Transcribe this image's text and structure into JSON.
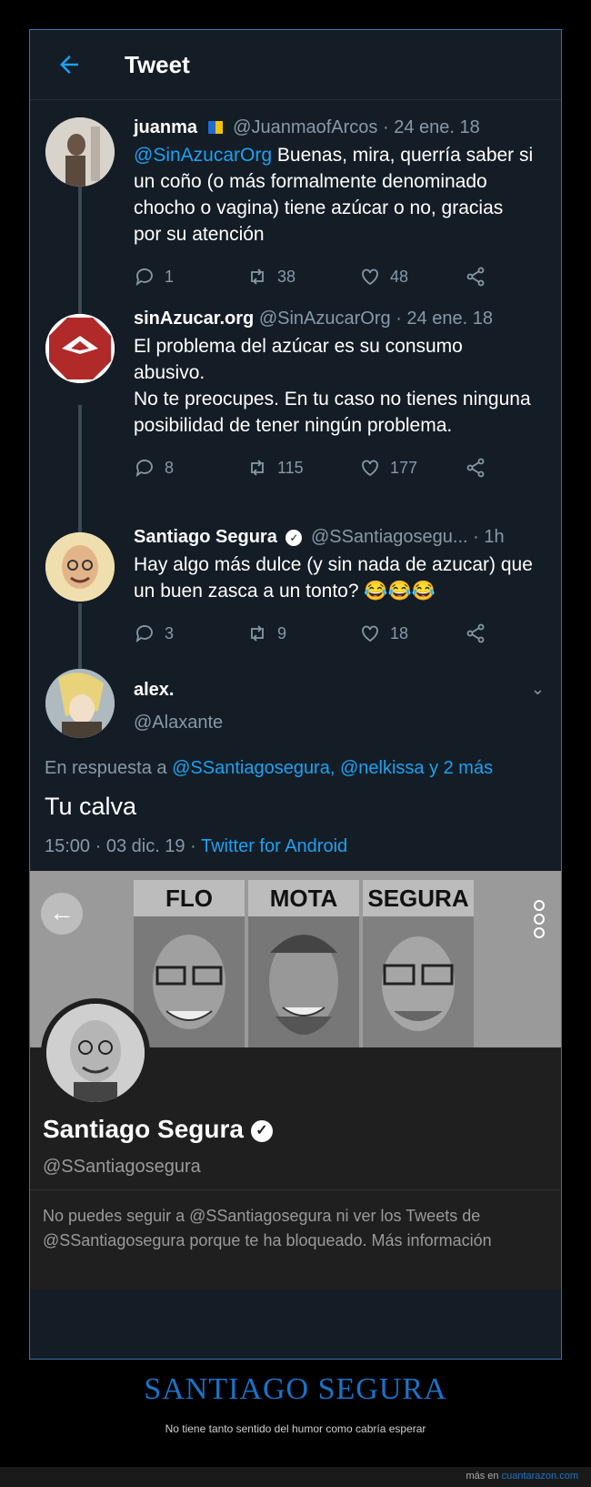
{
  "header": {
    "title": "Tweet"
  },
  "tweets": [
    {
      "name": "juanma",
      "handle": "@JuanmaofArcos",
      "date": "· 24 ene. 18",
      "mention": "@SinAzucarOrg",
      "text": " Buenas, mira, querría saber si un coño (o más formalmente denominado chocho o vagina) tiene azúcar o no, gracias por su atención",
      "replies": "1",
      "retweets": "38",
      "likes": "48"
    },
    {
      "name": "sinAzucar.org",
      "handle": "@SinAzucarOrg",
      "date": "· 24 ene. 18",
      "line1": "El problema del azúcar es su consumo abusivo.",
      "line2": "No te preocupes. En tu caso no tienes ninguna posibilidad de tener ningún problema.",
      "replies": "8",
      "retweets": "115",
      "likes": "177"
    },
    {
      "name": "Santiago Segura",
      "handle": "@SSantiagosegu...",
      "date": "· 1h",
      "text": "Hay algo más dulce (y sin nada de azucar) que un buen zasca a un tonto? 😂😂😂",
      "replies": "3",
      "retweets": "9",
      "likes": "18"
    }
  ],
  "main": {
    "name": "alex.",
    "handle": "@Alaxante",
    "reply_prefix": "En respuesta a ",
    "reply_to": "@SSantiagosegura, @nelkissa y 2 más",
    "text": "Tu calva",
    "time": "15:00 · 03 dic. 19 · ",
    "client": "Twitter for Android"
  },
  "profile": {
    "banner_labels": [
      "FLO",
      "MOTA",
      "SEGURA"
    ],
    "name": "Santiago Segura",
    "handle": "@SSantiagosegura",
    "blocked": "No puedes seguir a @SSantiagosegura ni ver los Tweets de @SSantiagosegura porque te ha bloqueado. Más información"
  },
  "footer": {
    "title": "SANTIAGO SEGURA",
    "subtitle": "No tiene tanto sentido del humor como cabría esperar",
    "credit_prefix": "más en ",
    "credit_link": "cuantarazon.com"
  }
}
